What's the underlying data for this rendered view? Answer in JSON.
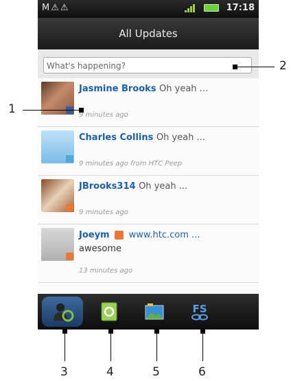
{
  "status_bar": {
    "left_icons": "M⚠⚠",
    "time": "17:18"
  },
  "header": {
    "title": "All Updates"
  },
  "search": {
    "placeholder": "What's happening?"
  },
  "updates": [
    {
      "name": "Jasmine Brooks",
      "message": "Oh yeah ...",
      "time": "9 minutes ago"
    },
    {
      "name": "Charles Collins",
      "message": "Oh yeah ...",
      "time": "9 minutes ago from HTC Peep"
    },
    {
      "name": "JBrooks314",
      "message": "Oh yeah ...",
      "time": "9 minutes ago"
    },
    {
      "name": "Joeym",
      "link": "www.htc.com ...",
      "message2": "awesome",
      "time": "13 minutes ago"
    }
  ],
  "callouts": [
    "1",
    "2",
    "3",
    "4",
    "5",
    "6"
  ],
  "tabs": [
    {
      "icon": "people-icon"
    },
    {
      "icon": "refresh-icon"
    },
    {
      "icon": "photo-icon"
    },
    {
      "icon": "fs-icon",
      "label": "FS"
    }
  ]
}
